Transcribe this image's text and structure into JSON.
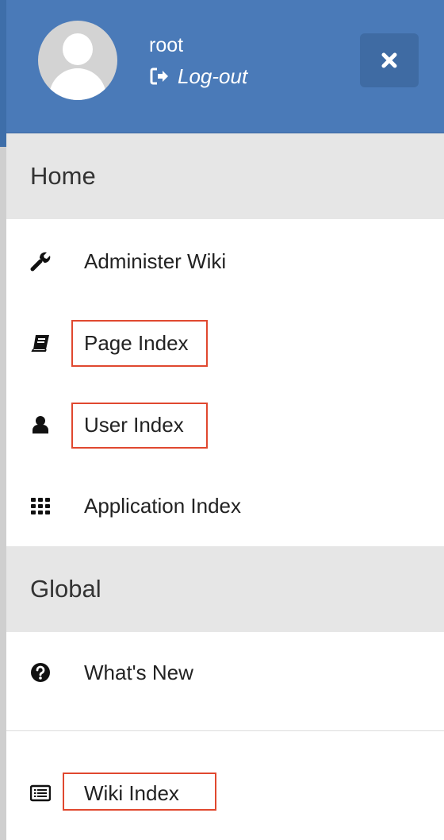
{
  "header": {
    "username": "root",
    "logout_label": "Log-out",
    "close_icon": "close-icon",
    "background_color": "#4a7ab8"
  },
  "sections": [
    {
      "label": "Home",
      "items": [
        {
          "label": "Administer Wiki",
          "icon": "wrench-icon"
        },
        {
          "label": "Page Index",
          "icon": "book-icon",
          "highlighted": true
        },
        {
          "label": "User Index",
          "icon": "user-icon",
          "highlighted": true
        },
        {
          "label": "Application Index",
          "icon": "grid-icon"
        }
      ]
    },
    {
      "label": "Global",
      "items": [
        {
          "label": "What's New",
          "icon": "question-circle-icon"
        },
        {
          "label": "Wiki Index",
          "icon": "list-alt-icon",
          "highlighted": true
        }
      ]
    }
  ],
  "highlight_color": "#e0482f"
}
